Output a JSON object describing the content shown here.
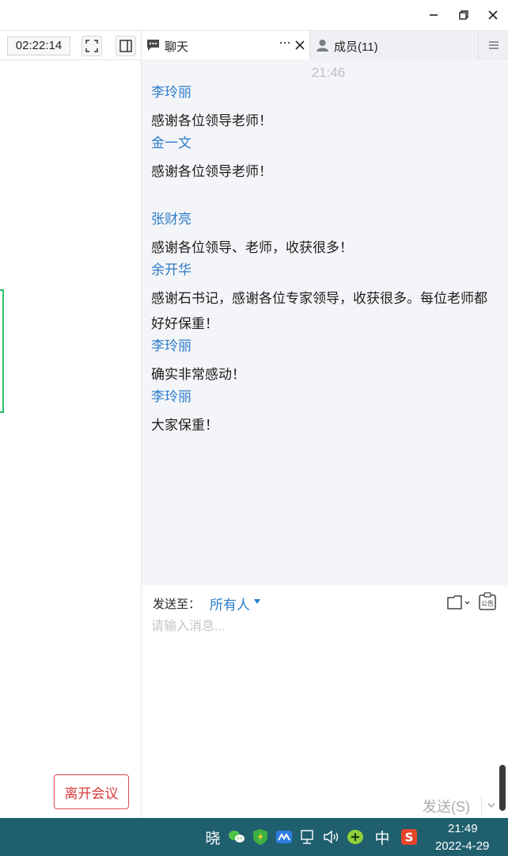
{
  "window": {
    "controls": [
      "minimize-icon",
      "restore-icon",
      "close-icon"
    ]
  },
  "meeting": {
    "elapsed": "02:22:14",
    "leave_label": "离开会议"
  },
  "tabs": {
    "chat_label": "聊天",
    "more_label": "···",
    "members_label": "成员(11)"
  },
  "chat": {
    "time": "21:46",
    "messages": [
      {
        "sender": "李玲丽",
        "lines": [
          "感谢各位领导老师！"
        ]
      },
      {
        "sender": "金一文",
        "lines": [
          "感谢各位领导老师！",
          ""
        ]
      },
      {
        "sender": "张财亮",
        "lines": [
          "感谢各位领导、老师，收获很多！"
        ]
      },
      {
        "sender": "余开华",
        "lines": [
          "感谢石书记，感谢各位专家领导，收获很多。每位老师都",
          "好好保重！"
        ]
      },
      {
        "sender": "李玲丽",
        "lines": [
          "确实非常感动！"
        ]
      },
      {
        "sender": "李玲丽",
        "lines": [
          "大家保重！"
        ]
      }
    ]
  },
  "composer": {
    "sendto_label": "发送至：",
    "sendto_value": "所有人",
    "placeholder": "请输入消息...",
    "send_label": "发送(S)",
    "notice_icon_text": "公告"
  },
  "taskbar": {
    "ime_label": "中",
    "xiao_label": "晓",
    "time": "21:49",
    "date": "2022-4-29"
  },
  "colors": {
    "accent": "#2b7cc9",
    "leave": "#d73a3a",
    "taskbar": "#1f5f6e",
    "chat_bg": "#f4f5f8"
  }
}
